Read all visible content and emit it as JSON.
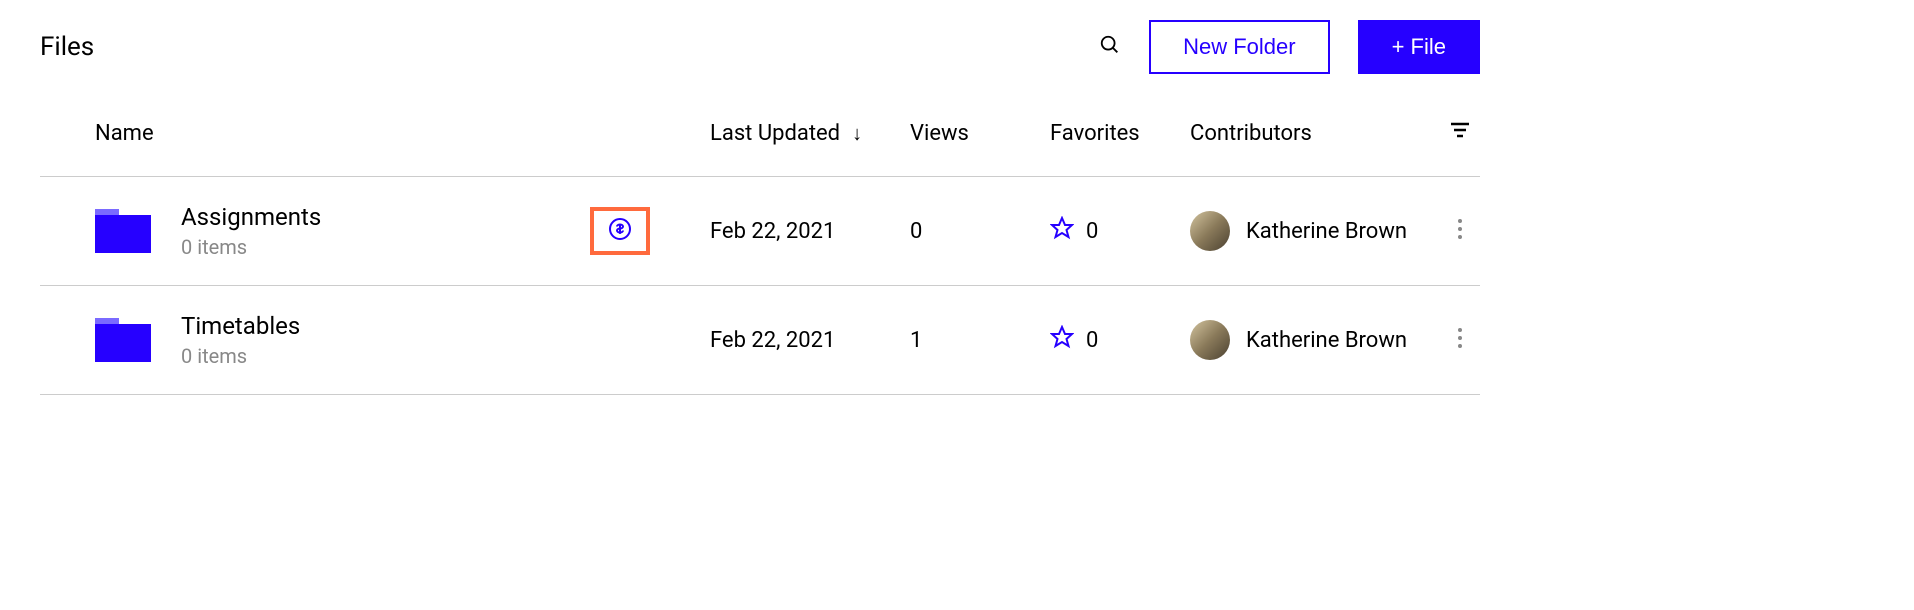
{
  "header": {
    "title": "Files",
    "new_folder": "New Folder",
    "add_file": "+ File"
  },
  "columns": {
    "name": "Name",
    "updated": "Last Updated",
    "views": "Views",
    "favorites": "Favorites",
    "contributors": "Contributors"
  },
  "rows": [
    {
      "name": "Assignments",
      "items": "0 items",
      "has_price_badge": true,
      "updated": "Feb 22, 2021",
      "views": "0",
      "favorites": "0",
      "contributor": "Katherine Brown"
    },
    {
      "name": "Timetables",
      "items": "0 items",
      "has_price_badge": false,
      "updated": "Feb 22, 2021",
      "views": "1",
      "favorites": "0",
      "contributor": "Katherine Brown"
    }
  ]
}
